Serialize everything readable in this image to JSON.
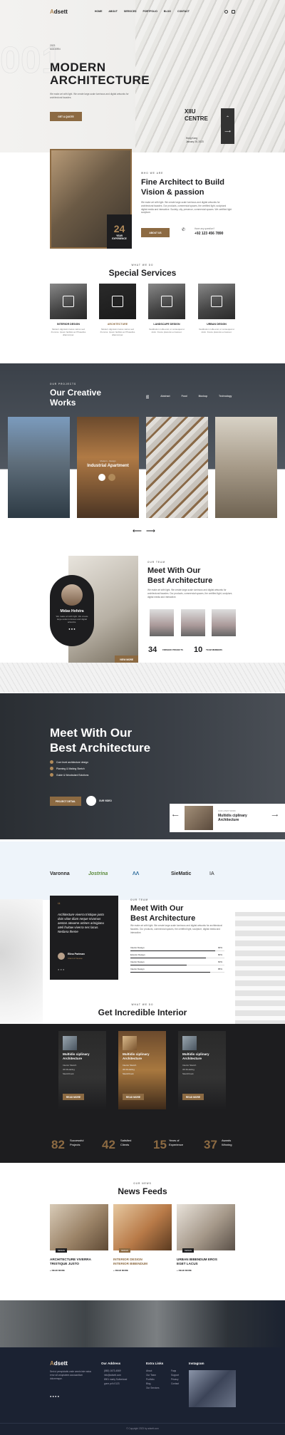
{
  "nav": {
    "logo_letter": "A",
    "logo_rest": "dsett",
    "links": [
      "HOME",
      "ABOUT",
      "SERVICES",
      "PORTFOLIO",
      "BLOG",
      "CONTACT"
    ]
  },
  "hero": {
    "ghost": "001",
    "small_line1": "2023",
    "small_line2": "MODERN",
    "title_line1": "MODERN",
    "title_line2": "ARCHITECTURE",
    "desc": "We make art with light. We create large-scale luminous and digital artworks for architectural facades.",
    "button": "GET A QUOTE",
    "centre_line1": "XIIU",
    "centre_line2": "CENTRE",
    "loc": "Hong Kong",
    "date": "January 25, 2023"
  },
  "about": {
    "badge_num": "24",
    "badge_l1": "YEAR",
    "badge_l2": "EXPERIENCE",
    "kicker": "WHO WE ARE",
    "title_l1": "Fine Architect to Build",
    "title_l2": "Vision & passion",
    "desc": "We make art with light. We create large-scale luminous and digital artworks for architectural facades. Our products, commercial spaces, the certified light, sculptural digital media and interactive. Society, city, presence, commercial spaces. We certified light sculpture.",
    "button": "ABOUT US",
    "q": "Have any question?",
    "phone": "+92 123 456 7890"
  },
  "services": {
    "kicker": "WHAT WE DO",
    "title": "Special Services",
    "items": [
      {
        "title": "INTERIOR DESIGN",
        "desc": "Modern dignissim lacus varius sed rhoncus. Ipsum facilisis ac Phasellus ullamcorper."
      },
      {
        "title": "ARCHITECTURE",
        "desc": "Modern dignissim lacus varius sed rhoncus. Ipsum facilisis ac Phasellus ullamcorper."
      },
      {
        "title": "LANDSCAPE DESIGN",
        "desc": "Vestibulum nulla erat, ut consequat ut dolor. Fusce placerat eu laoreet."
      },
      {
        "title": "URBAN DESIGN",
        "desc": "Vestibulum nulla erat, ut consequat ut dolor. Fusce placerat eu laoreet."
      }
    ]
  },
  "works": {
    "kicker": "OUR PROJECTS",
    "title_l1": "Our Creative",
    "title_l2": "Works",
    "tabs": [
      "All",
      "Abstract",
      "Food",
      "Mockup",
      "Technology"
    ],
    "feature_kicker": "Modern - Design",
    "feature_title": "Industrial Apartment",
    "prev": "⟵",
    "next": "⟶"
  },
  "team": {
    "name": "Midas Hofstra",
    "role": "We make art with light. We create large-scale luminous and digital artworks.",
    "kicker": "OUR TEAM",
    "title_l1": "Meet With Our",
    "title_l2": "Best Architecture",
    "desc": "We make art with light. We create large-scale luminous and digital artworks for architectural facades. Our products, commercial spaces, the certified light, sculpture, digital media and interactive.",
    "stat1_num": "34",
    "stat1_label": "FINISHED PROJECTS",
    "stat2_num": "10",
    "stat2_label": "TEAM MEMBERS",
    "view_btn": "VIEW MORE"
  },
  "banner": {
    "title_l1": "Meet With Our",
    "title_l2": "Best Architecture",
    "checks": [
      "Core level architecture design",
      "Planning & Making Sketch",
      "Guide & Woodsdard Solutions"
    ],
    "button": "PROJECT DETAIL",
    "play": "OUR VIDEO",
    "card_kicker": "OUR LATEST WORK",
    "card_title_l1": "Multidis ciplinary",
    "card_title_l2": "Architecture"
  },
  "logos": [
    "Varonna",
    "Jostrina",
    "ΛΛ",
    "SieMatic",
    "IA"
  ],
  "testimonial": {
    "quote": "Architecture viverra tristique justo duis vitae diam neque nivamus aestan ateuene artines arinigianu ateli fruitaw viverra nec lacus. Nedana theme",
    "name": "Elina Parlman",
    "role": "Client of Geese"
  },
  "skills": {
    "kicker": "OUR TEAM",
    "title_l1": "Meet With Our",
    "title_l2": "Best Architecture",
    "desc": "We make art with light. We create large-scale luminous and digital artworks for architectural facades. Our products, commercial spaces, the certified light, sculpture, digital media and interactive.",
    "bars": [
      {
        "label": "Interior Design",
        "pct": "90%",
        "value": 0.9
      },
      {
        "label": "Exterior Design",
        "pct": "80%",
        "value": 0.8
      },
      {
        "label": "Interior Design",
        "pct": "60%",
        "value": 0.6
      },
      {
        "label": "Interior Design",
        "pct": "85%",
        "value": 0.85
      }
    ]
  },
  "interior": {
    "kicker": "WHAT WE DO",
    "title": "Get Incredible Interior",
    "cards": [
      {
        "t1": "Multidis ciplinary",
        "t2": "Architecture",
        "items": [
          "Interior Sketch",
          "3D Modeling",
          "Sketchbook"
        ],
        "btn": "READ MORE"
      },
      {
        "t1": "Multidis ciplinary",
        "t2": "Architecture",
        "items": [
          "Interior Sketch",
          "3D Modeling",
          "Sketchbook"
        ],
        "btn": "READ MORE"
      },
      {
        "t1": "Multidis ciplinary",
        "t2": "Architecture",
        "items": [
          "Interior Sketch",
          "3D Modeling",
          "Sketchbook"
        ],
        "btn": "READ MORE"
      }
    ],
    "stats": [
      {
        "num": "82",
        "l1": "Successful",
        "l2": "Projects"
      },
      {
        "num": "42",
        "l1": "Satisfied",
        "l2": "Clients"
      },
      {
        "num": "15",
        "l1": "Years of",
        "l2": "Experience"
      },
      {
        "num": "37",
        "l1": "Awards",
        "l2": "Winning"
      }
    ]
  },
  "news": {
    "kicker": "OUR NEWS",
    "title": "News Feeds",
    "items": [
      {
        "tag": "DESIGN",
        "t1": "ARCHITECTURE VIVERRA",
        "t2": "TRISTIQUE JUSTO",
        "more": "+ READ MORE"
      },
      {
        "tag": "DESIGN",
        "t1": "INTERIOR DESIGN",
        "t2": "INTERIOR BIBENDUM",
        "more": "+ READ MORE"
      },
      {
        "tag": "DESIGN",
        "t1": "URBAN BIBENDUM EROS",
        "t2": "EGET LACUS",
        "more": "+ READ MORE"
      }
    ]
  },
  "footer": {
    "logo_letter": "A",
    "logo_rest": "dsett",
    "about": "Sed ut perspiciatis unde omnis iste natus error sit voluptatem accusantium doloremque.",
    "address_h": "Our Address",
    "address": [
      "(880) 1673-4569",
      "info@adsett.com",
      "8901 marty Sutherland",
      "gone yo'k 0123"
    ],
    "links_h": "Extra Links",
    "links1": [
      "About",
      "Our Team",
      "Portfolio",
      "Blog",
      "Our Services"
    ],
    "links2": [
      "Faqs",
      "Support",
      "Privacy",
      "Contact"
    ],
    "insta_h": "Instagram",
    "copyright": "© Copyright 2023 by adsett.com"
  }
}
